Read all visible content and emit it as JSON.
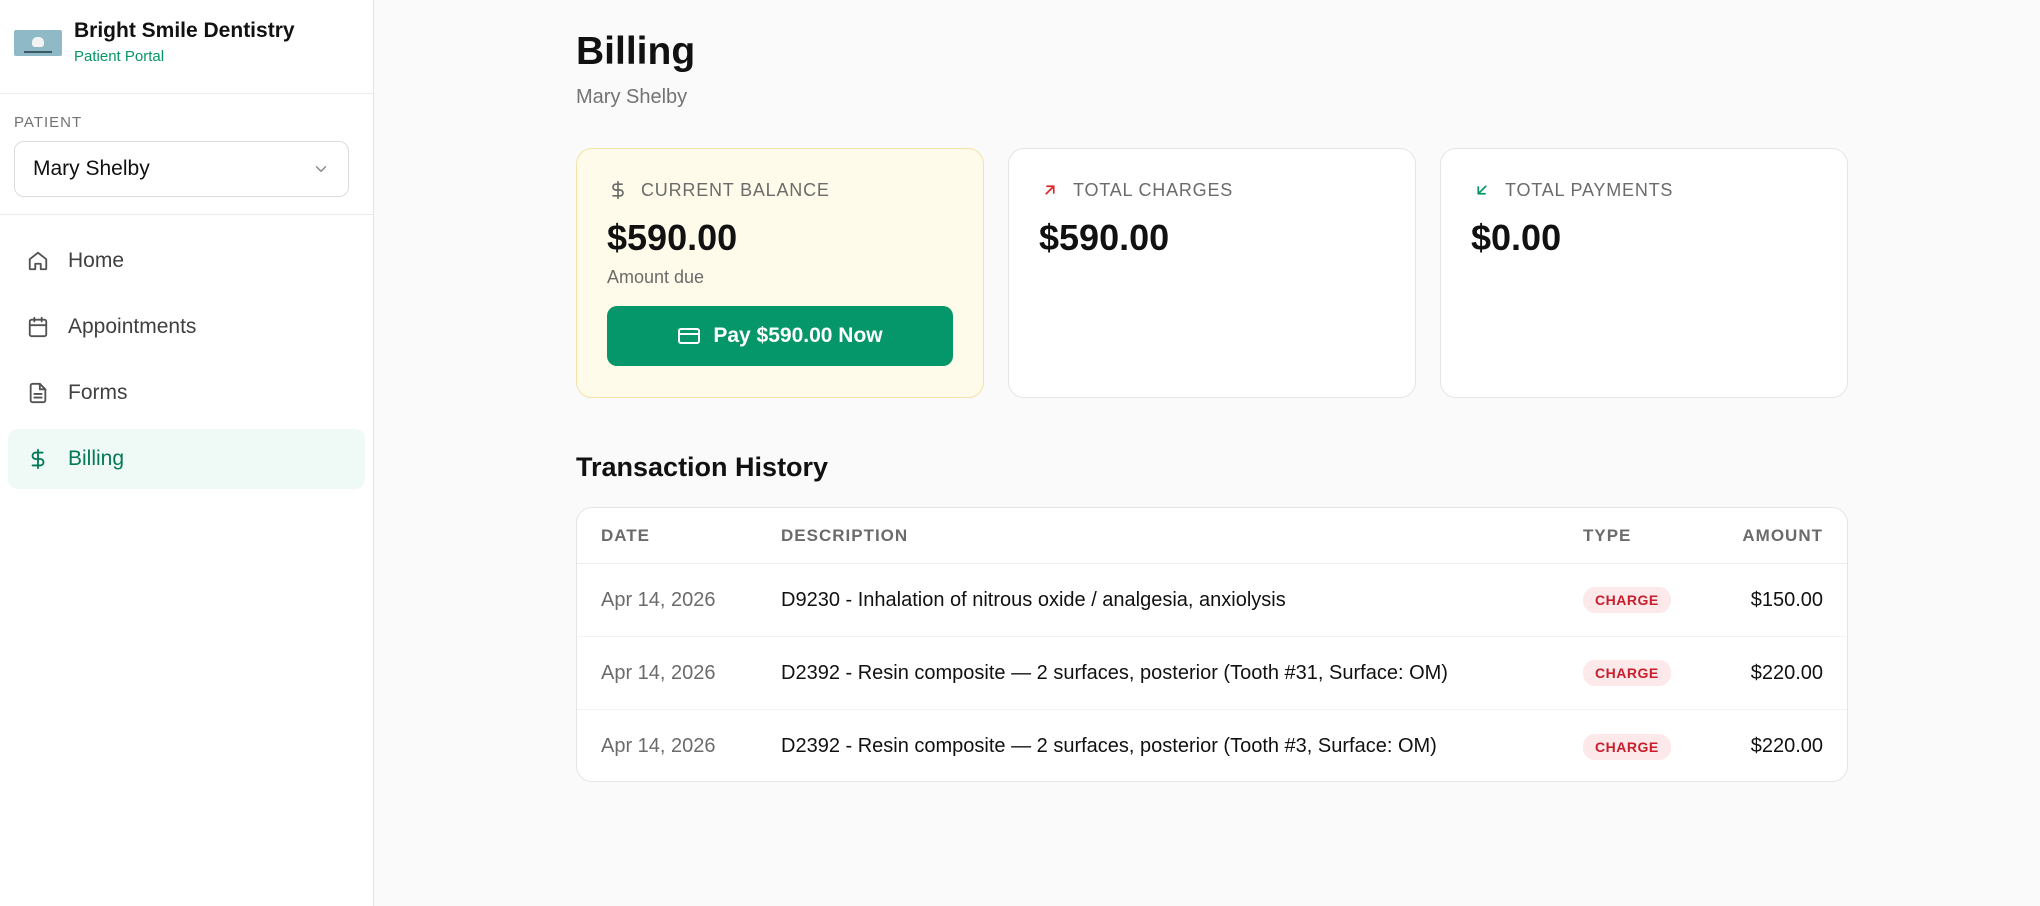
{
  "brand": {
    "name": "Bright Smile Dentistry",
    "subtitle": "Patient Portal",
    "logo_icon": "clinic-logo"
  },
  "patient_selector": {
    "label": "PATIENT",
    "value": "Mary Shelby",
    "icon": "chevron-down-icon"
  },
  "nav": {
    "items": [
      {
        "label": "Home",
        "icon": "home-icon"
      },
      {
        "label": "Appointments",
        "icon": "calendar-icon"
      },
      {
        "label": "Forms",
        "icon": "document-icon"
      },
      {
        "label": "Billing",
        "icon": "dollar-icon",
        "active": true
      }
    ]
  },
  "page": {
    "title": "Billing",
    "subtitle": "Mary Shelby"
  },
  "cards": {
    "balance": {
      "label": "CURRENT BALANCE",
      "value": "$590.00",
      "note": "Amount due",
      "button": "Pay $590.00 Now",
      "icon": "dollar-icon"
    },
    "charges": {
      "label": "TOTAL CHARGES",
      "value": "$590.00",
      "icon": "arrow-up-right-icon"
    },
    "payments": {
      "label": "TOTAL PAYMENTS",
      "value": "$0.00",
      "icon": "arrow-down-left-icon"
    }
  },
  "transactions": {
    "title": "Transaction History",
    "columns": [
      "DATE",
      "DESCRIPTION",
      "TYPE",
      "AMOUNT"
    ],
    "rows": [
      {
        "date": "Apr 14, 2026",
        "description": "D9230 - Inhalation of nitrous oxide / analgesia, anxiolysis",
        "type": "CHARGE",
        "amount": "$150.00"
      },
      {
        "date": "Apr 14, 2026",
        "description": "D2392 - Resin composite — 2 surfaces, posterior (Tooth #31, Surface: OM)",
        "type": "CHARGE",
        "amount": "$220.00"
      },
      {
        "date": "Apr 14, 2026",
        "description": "D2392 - Resin composite — 2 surfaces, posterior (Tooth #3, Surface: OM)",
        "type": "CHARGE",
        "amount": "$220.00"
      }
    ]
  },
  "colors": {
    "accent": "#059669",
    "active_nav_bg": "#effaf6",
    "balance_card_bg": "#fefbea",
    "charge_badge_bg": "#fde8ea",
    "charge_badge_text": "#c81e2b"
  }
}
